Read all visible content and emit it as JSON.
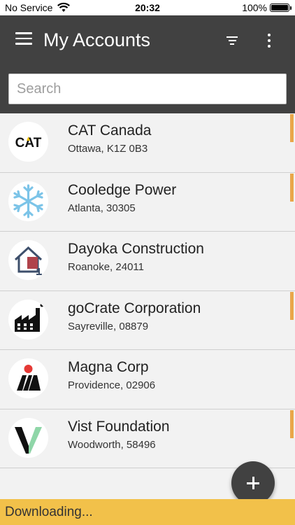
{
  "status_bar": {
    "carrier": "No Service",
    "time": "20:32",
    "battery": "100%"
  },
  "app_bar": {
    "title": "My Accounts",
    "menu_icon": "hamburger-menu-icon",
    "filter_icon": "filter-icon",
    "more_icon": "more-vert-icon"
  },
  "search": {
    "placeholder": "Search",
    "value": ""
  },
  "accounts": [
    {
      "name": "CAT Canada",
      "location": "Ottawa, K1Z 0B3",
      "flagged": true,
      "logo": "cat-logo",
      "logo_text": "CAT"
    },
    {
      "name": "Cooledge Power",
      "location": "Atlanta, 30305",
      "flagged": true,
      "logo": "snowflake-logo"
    },
    {
      "name": "Dayoka Construction",
      "location": "Roanoke, 24011",
      "flagged": false,
      "logo": "house-logo"
    },
    {
      "name": "goCrate Corporation",
      "location": "Sayreville, 08879",
      "flagged": true,
      "logo": "factory-logo"
    },
    {
      "name": "Magna Corp",
      "location": "Providence, 02906",
      "flagged": false,
      "logo": "magna-logo"
    },
    {
      "name": "Vist Foundation",
      "location": "Woodworth, 58496",
      "flagged": true,
      "logo": "vist-logo"
    }
  ],
  "fab": {
    "icon": "plus-icon"
  },
  "download_status": "Downloading...",
  "colors": {
    "app_bar": "#414141",
    "flag": "#e9a74a",
    "download_bar": "#f2c14a",
    "snowflake": "#7cc4e8",
    "magna_dot": "#e53935",
    "vist_green": "#8fd6a8"
  }
}
